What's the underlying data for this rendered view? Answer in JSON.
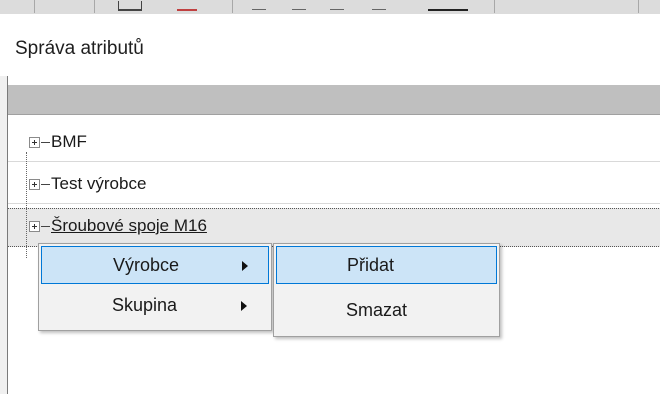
{
  "window": {
    "title": "Správa atributů"
  },
  "tree": {
    "nodes": [
      {
        "label": "BMF"
      },
      {
        "label": "Test výrobce"
      },
      {
        "label": "Šroubové spoje M16"
      }
    ]
  },
  "context_menu": {
    "items": [
      {
        "label": "Výrobce",
        "has_submenu": true,
        "highlighted": true
      },
      {
        "label": "Skupina",
        "has_submenu": true,
        "highlighted": false
      }
    ]
  },
  "submenu": {
    "items": [
      {
        "label": "Přidat",
        "highlighted": true
      },
      {
        "label": "Smazat",
        "highlighted": false
      }
    ]
  },
  "colors": {
    "highlight_fill": "#cce4f7",
    "highlight_border": "#0078d7",
    "grid_header": "#bfbfbf",
    "menu_background": "#f2f2f2"
  }
}
